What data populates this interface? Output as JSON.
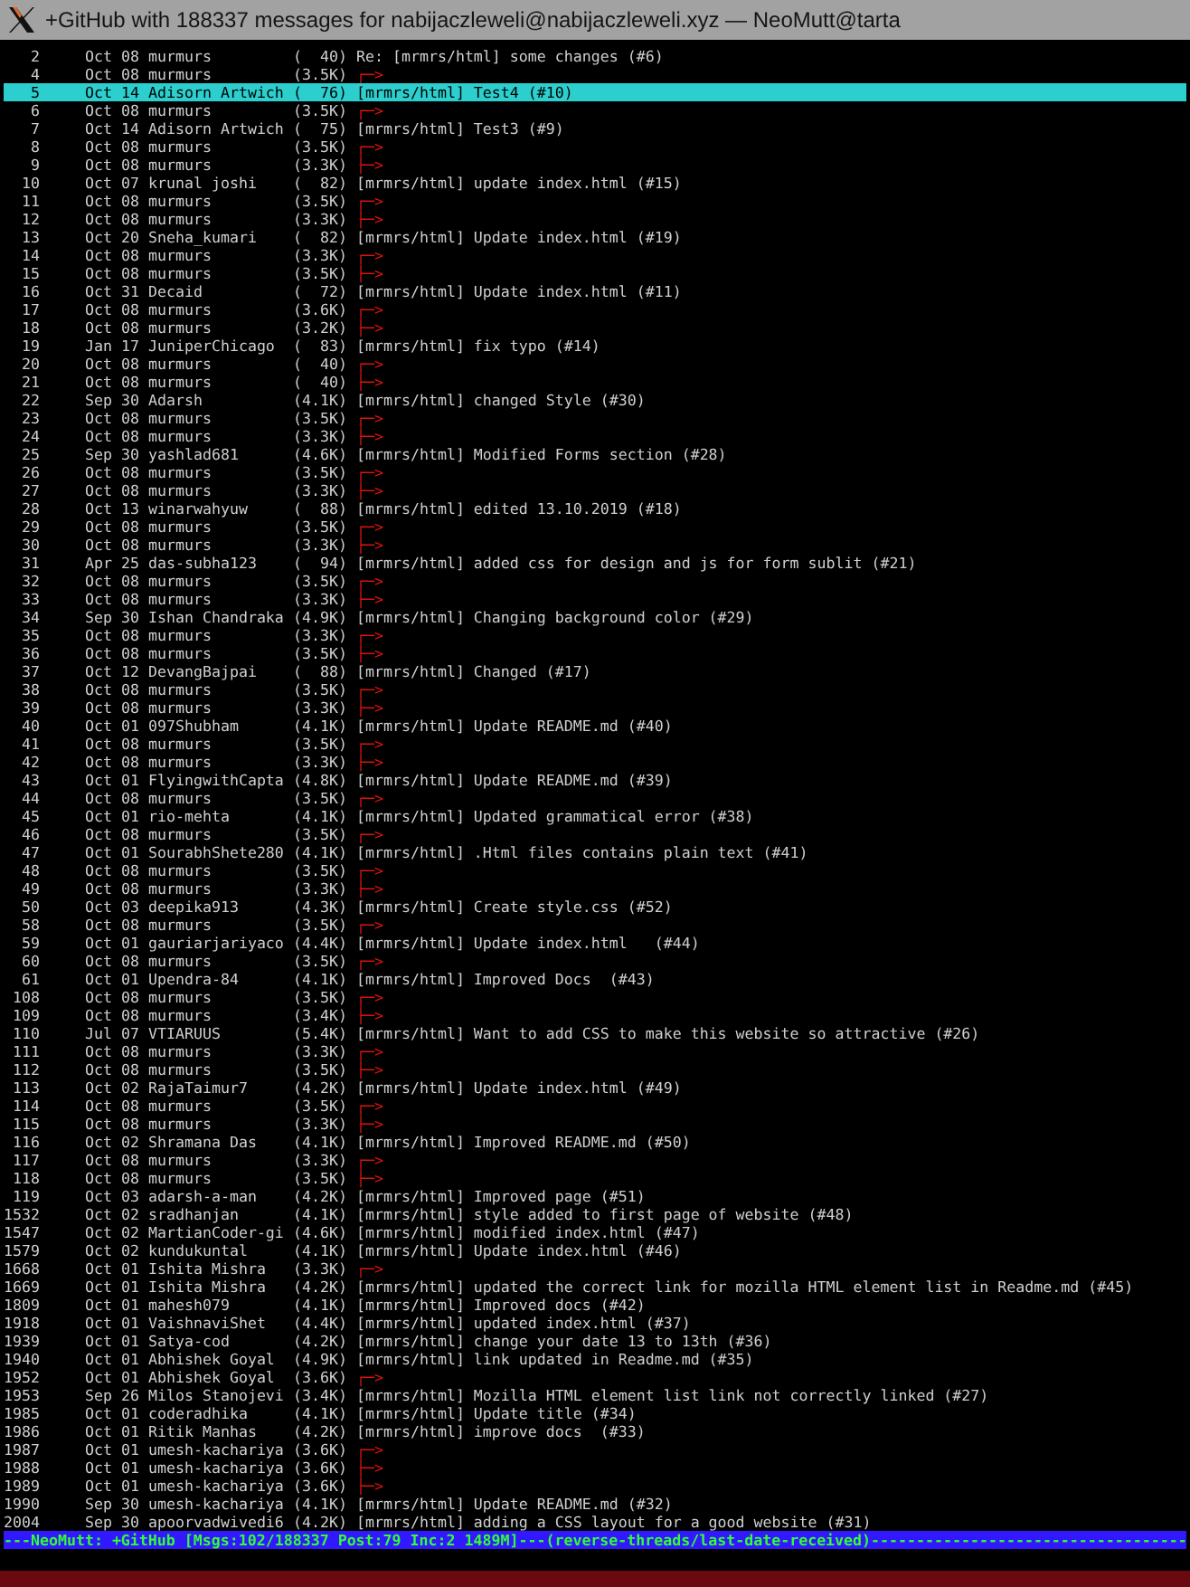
{
  "window": {
    "title": "+GitHub with 188337 messages for nabijaczleweli@nabijaczleweli.xyz — NeoMutt@tarta"
  },
  "index": {
    "rows": [
      {
        "kind": "message",
        "number": "2",
        "date": "Oct 08",
        "author": "murmurs",
        "size": "(  40)",
        "subject": "Re: [mrmrs/html] some changes (#6)",
        "selected": false
      },
      {
        "kind": "reply",
        "number": "4",
        "date": "Oct 08",
        "author": "murmurs",
        "size": "(3.5K)",
        "tree": "┌─>",
        "selected": false
      },
      {
        "kind": "message",
        "number": "5",
        "date": "Oct 14",
        "author": "Adisorn Artwich",
        "size": "(  76)",
        "subject": "[mrmrs/html] Test4 (#10)",
        "selected": true
      },
      {
        "kind": "reply",
        "number": "6",
        "date": "Oct 08",
        "author": "murmurs",
        "size": "(3.5K)",
        "tree": "┌─>",
        "selected": false
      },
      {
        "kind": "message",
        "number": "7",
        "date": "Oct 14",
        "author": "Adisorn Artwich",
        "size": "(  75)",
        "subject": "[mrmrs/html] Test3 (#9)",
        "selected": false
      },
      {
        "kind": "reply",
        "number": "8",
        "date": "Oct 08",
        "author": "murmurs",
        "size": "(3.5K)",
        "tree": "┌─>",
        "selected": false
      },
      {
        "kind": "reply",
        "number": "9",
        "date": "Oct 08",
        "author": "murmurs",
        "size": "(3.3K)",
        "tree": "├─>",
        "selected": false
      },
      {
        "kind": "message",
        "number": "10",
        "date": "Oct 07",
        "author": "krunal joshi",
        "size": "(  82)",
        "subject": "[mrmrs/html] update index.html (#15)",
        "selected": false
      },
      {
        "kind": "reply",
        "number": "11",
        "date": "Oct 08",
        "author": "murmurs",
        "size": "(3.5K)",
        "tree": "┌─>",
        "selected": false
      },
      {
        "kind": "reply",
        "number": "12",
        "date": "Oct 08",
        "author": "murmurs",
        "size": "(3.3K)",
        "tree": "├─>",
        "selected": false
      },
      {
        "kind": "message",
        "number": "13",
        "date": "Oct 20",
        "author": "Sneha_kumari",
        "size": "(  82)",
        "subject": "[mrmrs/html] Update index.html (#19)",
        "selected": false
      },
      {
        "kind": "reply",
        "number": "14",
        "date": "Oct 08",
        "author": "murmurs",
        "size": "(3.3K)",
        "tree": "┌─>",
        "selected": false
      },
      {
        "kind": "reply",
        "number": "15",
        "date": "Oct 08",
        "author": "murmurs",
        "size": "(3.5K)",
        "tree": "├─>",
        "selected": false
      },
      {
        "kind": "message",
        "number": "16",
        "date": "Oct 31",
        "author": "Decaid",
        "size": "(  72)",
        "subject": "[mrmrs/html] Update index.html (#11)",
        "selected": false
      },
      {
        "kind": "reply",
        "number": "17",
        "date": "Oct 08",
        "author": "murmurs",
        "size": "(3.6K)",
        "tree": "┌─>",
        "selected": false
      },
      {
        "kind": "reply",
        "number": "18",
        "date": "Oct 08",
        "author": "murmurs",
        "size": "(3.2K)",
        "tree": "├─>",
        "selected": false
      },
      {
        "kind": "message",
        "number": "19",
        "date": "Jan 17",
        "author": "JuniperChicago",
        "size": "(  83)",
        "subject": "[mrmrs/html] fix typo (#14)",
        "selected": false
      },
      {
        "kind": "reply",
        "number": "20",
        "date": "Oct 08",
        "author": "murmurs",
        "size": "(  40)",
        "tree": "┌─>",
        "selected": false
      },
      {
        "kind": "reply",
        "number": "21",
        "date": "Oct 08",
        "author": "murmurs",
        "size": "(  40)",
        "tree": "├─>",
        "selected": false
      },
      {
        "kind": "message",
        "number": "22",
        "date": "Sep 30",
        "author": "Adarsh",
        "size": "(4.1K)",
        "subject": "[mrmrs/html] changed Style (#30)",
        "selected": false
      },
      {
        "kind": "reply",
        "number": "23",
        "date": "Oct 08",
        "author": "murmurs",
        "size": "(3.5K)",
        "tree": "┌─>",
        "selected": false
      },
      {
        "kind": "reply",
        "number": "24",
        "date": "Oct 08",
        "author": "murmurs",
        "size": "(3.3K)",
        "tree": "├─>",
        "selected": false
      },
      {
        "kind": "message",
        "number": "25",
        "date": "Sep 30",
        "author": "yashlad681",
        "size": "(4.6K)",
        "subject": "[mrmrs/html] Modified Forms section (#28)",
        "selected": false
      },
      {
        "kind": "reply",
        "number": "26",
        "date": "Oct 08",
        "author": "murmurs",
        "size": "(3.5K)",
        "tree": "┌─>",
        "selected": false
      },
      {
        "kind": "reply",
        "number": "27",
        "date": "Oct 08",
        "author": "murmurs",
        "size": "(3.3K)",
        "tree": "├─>",
        "selected": false
      },
      {
        "kind": "message",
        "number": "28",
        "date": "Oct 13",
        "author": "winarwahyuw",
        "size": "(  88)",
        "subject": "[mrmrs/html] edited 13.10.2019 (#18)",
        "selected": false
      },
      {
        "kind": "reply",
        "number": "29",
        "date": "Oct 08",
        "author": "murmurs",
        "size": "(3.5K)",
        "tree": "┌─>",
        "selected": false
      },
      {
        "kind": "reply",
        "number": "30",
        "date": "Oct 08",
        "author": "murmurs",
        "size": "(3.3K)",
        "tree": "├─>",
        "selected": false
      },
      {
        "kind": "message",
        "number": "31",
        "date": "Apr 25",
        "author": "das-subha123",
        "size": "(  94)",
        "subject": "[mrmrs/html] added css for design and js for form sublit (#21)",
        "selected": false
      },
      {
        "kind": "reply",
        "number": "32",
        "date": "Oct 08",
        "author": "murmurs",
        "size": "(3.5K)",
        "tree": "┌─>",
        "selected": false
      },
      {
        "kind": "reply",
        "number": "33",
        "date": "Oct 08",
        "author": "murmurs",
        "size": "(3.3K)",
        "tree": "├─>",
        "selected": false
      },
      {
        "kind": "message",
        "number": "34",
        "date": "Sep 30",
        "author": "Ishan Chandraka",
        "size": "(4.9K)",
        "subject": "[mrmrs/html] Changing background color (#29)",
        "selected": false
      },
      {
        "kind": "reply",
        "number": "35",
        "date": "Oct 08",
        "author": "murmurs",
        "size": "(3.3K)",
        "tree": "┌─>",
        "selected": false
      },
      {
        "kind": "reply",
        "number": "36",
        "date": "Oct 08",
        "author": "murmurs",
        "size": "(3.5K)",
        "tree": "├─>",
        "selected": false
      },
      {
        "kind": "message",
        "number": "37",
        "date": "Oct 12",
        "author": "DevangBajpai",
        "size": "(  88)",
        "subject": "[mrmrs/html] Changed (#17)",
        "selected": false
      },
      {
        "kind": "reply",
        "number": "38",
        "date": "Oct 08",
        "author": "murmurs",
        "size": "(3.5K)",
        "tree": "┌─>",
        "selected": false
      },
      {
        "kind": "reply",
        "number": "39",
        "date": "Oct 08",
        "author": "murmurs",
        "size": "(3.3K)",
        "tree": "├─>",
        "selected": false
      },
      {
        "kind": "message",
        "number": "40",
        "date": "Oct 01",
        "author": "097Shubham",
        "size": "(4.1K)",
        "subject": "[mrmrs/html] Update README.md (#40)",
        "selected": false
      },
      {
        "kind": "reply",
        "number": "41",
        "date": "Oct 08",
        "author": "murmurs",
        "size": "(3.5K)",
        "tree": "┌─>",
        "selected": false
      },
      {
        "kind": "reply",
        "number": "42",
        "date": "Oct 08",
        "author": "murmurs",
        "size": "(3.3K)",
        "tree": "├─>",
        "selected": false
      },
      {
        "kind": "message",
        "number": "43",
        "date": "Oct 01",
        "author": "FlyingwithCapta",
        "size": "(4.8K)",
        "subject": "[mrmrs/html] Update README.md (#39)",
        "selected": false
      },
      {
        "kind": "reply",
        "number": "44",
        "date": "Oct 08",
        "author": "murmurs",
        "size": "(3.5K)",
        "tree": "┌─>",
        "selected": false
      },
      {
        "kind": "message",
        "number": "45",
        "date": "Oct 01",
        "author": "rio-mehta",
        "size": "(4.1K)",
        "subject": "[mrmrs/html] Updated grammatical error (#38)",
        "selected": false
      },
      {
        "kind": "reply",
        "number": "46",
        "date": "Oct 08",
        "author": "murmurs",
        "size": "(3.5K)",
        "tree": "┌─>",
        "selected": false
      },
      {
        "kind": "message",
        "number": "47",
        "date": "Oct 01",
        "author": "SourabhShete280",
        "size": "(4.1K)",
        "subject": "[mrmrs/html] .Html files contains plain text (#41)",
        "selected": false
      },
      {
        "kind": "reply",
        "number": "48",
        "date": "Oct 08",
        "author": "murmurs",
        "size": "(3.5K)",
        "tree": "┌─>",
        "selected": false
      },
      {
        "kind": "reply",
        "number": "49",
        "date": "Oct 08",
        "author": "murmurs",
        "size": "(3.3K)",
        "tree": "├─>",
        "selected": false
      },
      {
        "kind": "message",
        "number": "50",
        "date": "Oct 03",
        "author": "deepika913",
        "size": "(4.3K)",
        "subject": "[mrmrs/html] Create style.css (#52)",
        "selected": false
      },
      {
        "kind": "reply",
        "number": "58",
        "date": "Oct 08",
        "author": "murmurs",
        "size": "(3.5K)",
        "tree": "┌─>",
        "selected": false
      },
      {
        "kind": "message",
        "number": "59",
        "date": "Oct 01",
        "author": "gauriarjariyaco",
        "size": "(4.4K)",
        "subject": "[mrmrs/html] Update index.html   (#44)",
        "selected": false
      },
      {
        "kind": "reply",
        "number": "60",
        "date": "Oct 08",
        "author": "murmurs",
        "size": "(3.5K)",
        "tree": "┌─>",
        "selected": false
      },
      {
        "kind": "message",
        "number": "61",
        "date": "Oct 01",
        "author": "Upendra-84",
        "size": "(4.1K)",
        "subject": "[mrmrs/html] Improved Docs  (#43)",
        "selected": false
      },
      {
        "kind": "reply",
        "number": "108",
        "date": "Oct 08",
        "author": "murmurs",
        "size": "(3.5K)",
        "tree": "┌─>",
        "selected": false
      },
      {
        "kind": "reply",
        "number": "109",
        "date": "Oct 08",
        "author": "murmurs",
        "size": "(3.4K)",
        "tree": "├─>",
        "selected": false
      },
      {
        "kind": "message",
        "number": "110",
        "date": "Jul 07",
        "author": "VTIARUUS",
        "size": "(5.4K)",
        "subject": "[mrmrs/html] Want to add CSS to make this website so attractive (#26)",
        "selected": false
      },
      {
        "kind": "reply",
        "number": "111",
        "date": "Oct 08",
        "author": "murmurs",
        "size": "(3.3K)",
        "tree": "┌─>",
        "selected": false
      },
      {
        "kind": "reply",
        "number": "112",
        "date": "Oct 08",
        "author": "murmurs",
        "size": "(3.5K)",
        "tree": "├─>",
        "selected": false
      },
      {
        "kind": "message",
        "number": "113",
        "date": "Oct 02",
        "author": "RajaTaimur7",
        "size": "(4.2K)",
        "subject": "[mrmrs/html] Update index.html (#49)",
        "selected": false
      },
      {
        "kind": "reply",
        "number": "114",
        "date": "Oct 08",
        "author": "murmurs",
        "size": "(3.5K)",
        "tree": "┌─>",
        "selected": false
      },
      {
        "kind": "reply",
        "number": "115",
        "date": "Oct 08",
        "author": "murmurs",
        "size": "(3.3K)",
        "tree": "├─>",
        "selected": false
      },
      {
        "kind": "message",
        "number": "116",
        "date": "Oct 02",
        "author": "Shramana Das",
        "size": "(4.1K)",
        "subject": "[mrmrs/html] Improved README.md (#50)",
        "selected": false
      },
      {
        "kind": "reply",
        "number": "117",
        "date": "Oct 08",
        "author": "murmurs",
        "size": "(3.3K)",
        "tree": "┌─>",
        "selected": false
      },
      {
        "kind": "reply",
        "number": "118",
        "date": "Oct 08",
        "author": "murmurs",
        "size": "(3.5K)",
        "tree": "├─>",
        "selected": false
      },
      {
        "kind": "message",
        "number": "119",
        "date": "Oct 03",
        "author": "adarsh-a-man",
        "size": "(4.2K)",
        "subject": "[mrmrs/html] Improved page (#51)",
        "selected": false
      },
      {
        "kind": "message",
        "number": "1532",
        "date": "Oct 02",
        "author": "sradhanjan",
        "size": "(4.1K)",
        "subject": "[mrmrs/html] style added to first page of website (#48)",
        "selected": false
      },
      {
        "kind": "message",
        "number": "1547",
        "date": "Oct 02",
        "author": "MartianCoder-gi",
        "size": "(4.6K)",
        "subject": "[mrmrs/html] modified index.html (#47)",
        "selected": false
      },
      {
        "kind": "message",
        "number": "1579",
        "date": "Oct 02",
        "author": "kundukuntal",
        "size": "(4.1K)",
        "subject": "[mrmrs/html] Update index.html (#46)",
        "selected": false
      },
      {
        "kind": "reply",
        "number": "1668",
        "date": "Oct 01",
        "author": "Ishita Mishra",
        "size": "(3.3K)",
        "tree": "┌─>",
        "selected": false
      },
      {
        "kind": "message",
        "number": "1669",
        "date": "Oct 01",
        "author": "Ishita Mishra",
        "size": "(4.2K)",
        "subject": "[mrmrs/html] updated the correct link for mozilla HTML element list in Readme.md (#45)",
        "selected": false
      },
      {
        "kind": "message",
        "number": "1809",
        "date": "Oct 01",
        "author": "mahesh079",
        "size": "(4.1K)",
        "subject": "[mrmrs/html] Improved docs (#42)",
        "selected": false
      },
      {
        "kind": "message",
        "number": "1918",
        "date": "Oct 01",
        "author": "VaishnaviShet",
        "size": "(4.4K)",
        "subject": "[mrmrs/html] updated index.html (#37)",
        "selected": false
      },
      {
        "kind": "message",
        "number": "1939",
        "date": "Oct 01",
        "author": "Satya-cod",
        "size": "(4.2K)",
        "subject": "[mrmrs/html] change your date 13 to 13th (#36)",
        "selected": false
      },
      {
        "kind": "message",
        "number": "1940",
        "date": "Oct 01",
        "author": "Abhishek Goyal",
        "size": "(4.9K)",
        "subject": "[mrmrs/html] link updated in Readme.md (#35)",
        "selected": false
      },
      {
        "kind": "reply",
        "number": "1952",
        "date": "Oct 01",
        "author": "Abhishek Goyal",
        "size": "(3.6K)",
        "tree": "┌─>",
        "selected": false
      },
      {
        "kind": "message",
        "number": "1953",
        "date": "Sep 26",
        "author": "Milos Stanojevi",
        "size": "(3.4K)",
        "subject": "[mrmrs/html] Mozilla HTML element list link not correctly linked (#27)",
        "selected": false
      },
      {
        "kind": "message",
        "number": "1985",
        "date": "Oct 01",
        "author": "coderadhika",
        "size": "(4.1K)",
        "subject": "[mrmrs/html] Update title (#34)",
        "selected": false
      },
      {
        "kind": "message",
        "number": "1986",
        "date": "Oct 01",
        "author": "Ritik Manhas",
        "size": "(4.2K)",
        "subject": "[mrmrs/html] improve docs  (#33)",
        "selected": false
      },
      {
        "kind": "reply",
        "number": "1987",
        "date": "Oct 01",
        "author": "umesh-kachariya",
        "size": "(3.6K)",
        "tree": "┌─>",
        "selected": false
      },
      {
        "kind": "reply",
        "number": "1988",
        "date": "Oct 01",
        "author": "umesh-kachariya",
        "size": "(3.6K)",
        "tree": "├─>",
        "selected": false
      },
      {
        "kind": "reply",
        "number": "1989",
        "date": "Oct 01",
        "author": "umesh-kachariya",
        "size": "(3.6K)",
        "tree": "├─>",
        "selected": false
      },
      {
        "kind": "message",
        "number": "1990",
        "date": "Sep 30",
        "author": "umesh-kachariya",
        "size": "(4.1K)",
        "subject": "[mrmrs/html] Update README.md (#32)",
        "selected": false
      },
      {
        "kind": "message",
        "number": "2004",
        "date": "Sep 30",
        "author": "apoorvadwivedi6",
        "size": "(4.2K)",
        "subject": "[mrmrs/html] adding a CSS layout for a good website (#31)",
        "selected": false
      }
    ]
  },
  "status_bar": {
    "text": "---NeoMutt: +GitHub [Msgs:102/188337 Post:79 Inc:2 1489M]---(reverse-threads/last-date-received)-----------------------------------"
  }
}
